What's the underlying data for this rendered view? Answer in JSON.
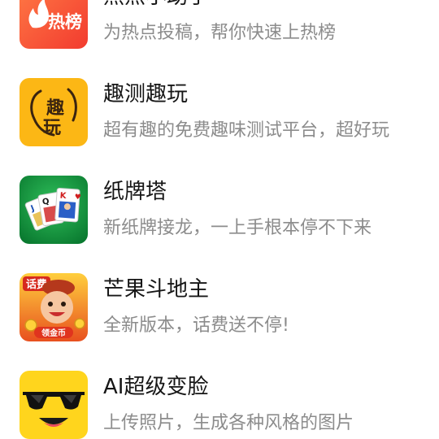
{
  "items": [
    {
      "title": "热点小助手",
      "description": "为热点投稿，帮你快速上热榜",
      "icon": "hot-list-icon",
      "icon_text": "热榜",
      "icon_color": "#f3542f"
    },
    {
      "title": "趣测趣玩",
      "description": "超有趣的免费趣味测试平台，超好玩",
      "icon": "quce-quwan-logo-icon",
      "icon_text": "趣玩",
      "icon_color": "#fcb715"
    },
    {
      "title": "纸牌塔",
      "description": "新纸牌接龙，一上手根本停不下来",
      "icon": "playing-cards-icon",
      "icon_text": "J Q K",
      "icon_color": "#0f8f3a"
    },
    {
      "title": "芒果斗地主",
      "description": "全新版本，话费送不停!",
      "icon": "landlord-character-icon",
      "icon_text": "话费 领金币",
      "icon_color": "#f07d1f"
    },
    {
      "title": "AI超级变脸",
      "description": "上传照片，生成各种风格的图片",
      "icon": "sunglasses-face-icon",
      "icon_color": "#ffd51d"
    }
  ]
}
